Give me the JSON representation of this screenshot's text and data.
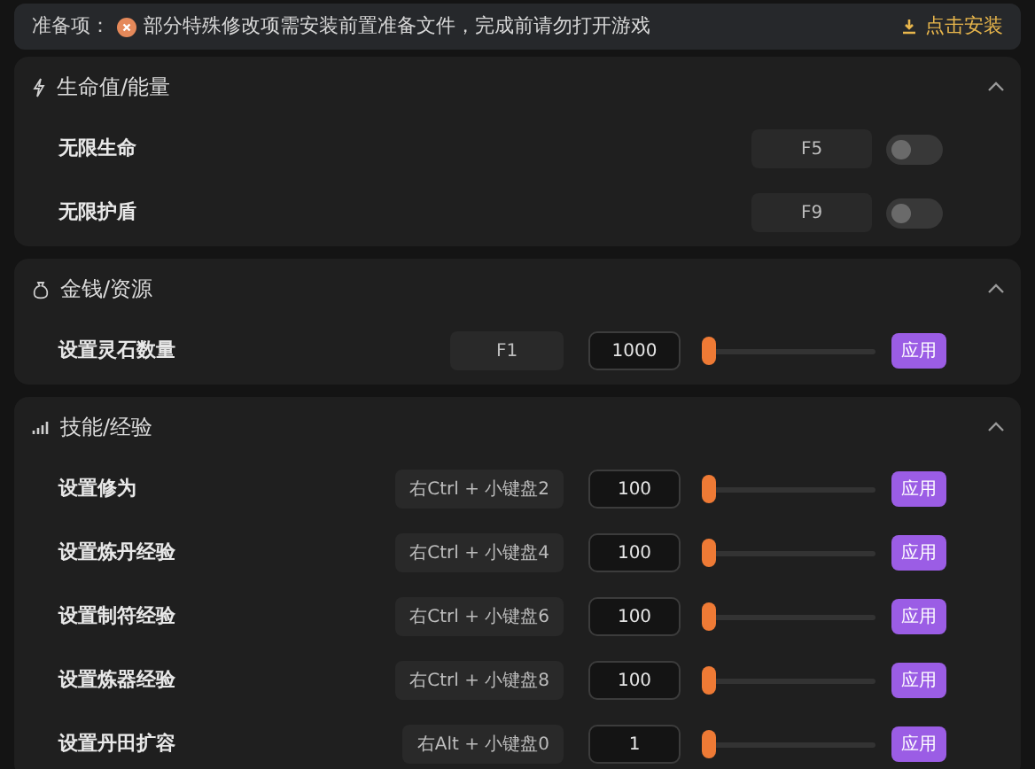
{
  "banner": {
    "label": "准备项：",
    "message": "部分特殊修改项需安装前置准备文件，完成前请勿打开游戏",
    "action": "点击安装"
  },
  "sections": [
    {
      "title": "生命值/能量",
      "expanded": true,
      "rows": [
        {
          "kind": "toggle",
          "label": "无限生命",
          "hotkey": "F5",
          "on": false
        },
        {
          "kind": "toggle",
          "label": "无限护盾",
          "hotkey": "F9",
          "on": false
        }
      ]
    },
    {
      "title": "金钱/资源",
      "expanded": true,
      "rows": [
        {
          "kind": "slider",
          "label": "设置灵石数量",
          "hotkey": "F1",
          "value": "1000",
          "level": 0,
          "button": "应用"
        }
      ]
    },
    {
      "title": "技能/经验",
      "expanded": true,
      "rows": [
        {
          "kind": "slider",
          "label": "设置修为",
          "hotkey": "右Ctrl + 小键盘2",
          "value": "100",
          "level": 0,
          "button": "应用"
        },
        {
          "kind": "slider",
          "label": "设置炼丹经验",
          "hotkey": "右Ctrl + 小键盘4",
          "value": "100",
          "level": 0,
          "button": "应用"
        },
        {
          "kind": "slider",
          "label": "设置制符经验",
          "hotkey": "右Ctrl + 小键盘6",
          "value": "100",
          "level": 0,
          "button": "应用"
        },
        {
          "kind": "slider",
          "label": "设置炼器经验",
          "hotkey": "右Ctrl + 小键盘8",
          "value": "100",
          "level": 0,
          "button": "应用"
        },
        {
          "kind": "slider",
          "label": "设置丹田扩容",
          "hotkey": "右Alt + 小键盘0",
          "value": "1",
          "level": 0,
          "button": "应用"
        }
      ]
    }
  ]
}
